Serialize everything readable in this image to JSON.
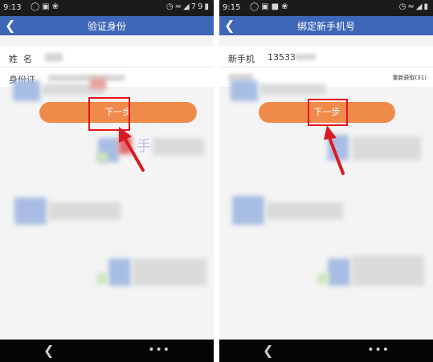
{
  "left": {
    "status": {
      "time": "9:13",
      "battery": "79"
    },
    "title": "验证身份",
    "fields": [
      {
        "label": "姓  名"
      },
      {
        "label": "身份证"
      }
    ],
    "next_label": "下一步",
    "watermark_char": "手"
  },
  "right": {
    "status": {
      "time": "9:15"
    },
    "title": "绑定新手机号",
    "phone": {
      "label": "新手机",
      "value": "13533"
    },
    "code": {
      "resend_label": "重新获取(31)"
    },
    "next_label": "下一步"
  },
  "icons": {
    "back": "back-arrow-icon",
    "more": "more-dots-icon",
    "status_left": [
      "chat-bubble-icon",
      "image-icon",
      "paw-icon"
    ],
    "status_right": [
      "alarm-clock-icon",
      "wifi-icon",
      "signal-icon",
      "battery-icon"
    ]
  },
  "colors": {
    "titlebar": "#3f67b8",
    "button": "#f08a4b",
    "highlight": "#e5161c",
    "statusbar": "#1b1b1b",
    "navbar": "#050505"
  }
}
